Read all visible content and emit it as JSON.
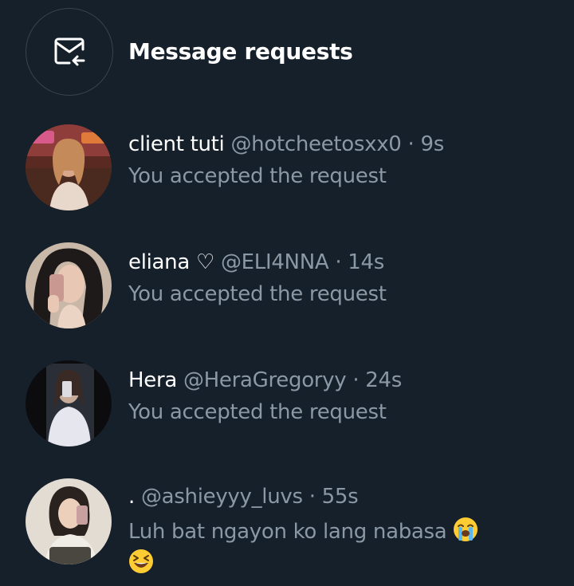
{
  "header": {
    "title": "Message requests",
    "icon": "envelope-arrow-icon"
  },
  "conversations": [
    {
      "name": "client tuti",
      "handle": "@hotcheetosxx0",
      "separator": "·",
      "time": "9s",
      "preview": "You accepted the request"
    },
    {
      "name": "eliana ♡",
      "handle": "@ELI4NNA",
      "separator": "·",
      "time": "14s",
      "preview": "You accepted the request"
    },
    {
      "name": "Hera",
      "handle": "@HeraGregoryy",
      "separator": "·",
      "time": "24s",
      "preview": "You accepted the request"
    },
    {
      "name": ".",
      "handle": "@ashieyyy_luvs",
      "separator": "·",
      "time": "55s",
      "preview": "Luh bat ngayon ko lang nabasa",
      "emojis": [
        "loudly-crying-face",
        "grinning-squinting-face"
      ]
    }
  ],
  "colors": {
    "background": "#15202b",
    "primary_text": "#ffffff",
    "secondary_text": "#8b98a5",
    "border": "#38444d"
  }
}
